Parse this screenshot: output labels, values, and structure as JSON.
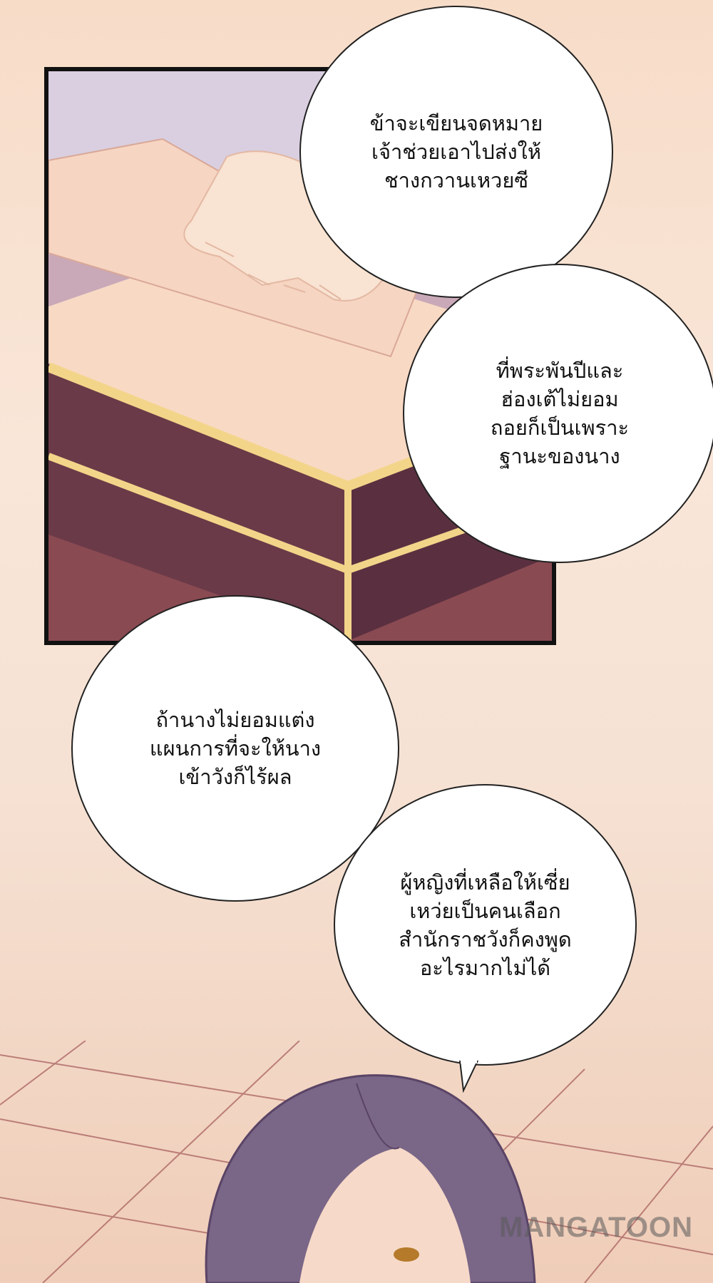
{
  "bubbles": [
    {
      "text": "ข้าจะเขียนจดหมาย\nเจ้าช่วยเอาไปส่งให้\nชางกวานเหวยซี"
    },
    {
      "text": "ที่พระพันปีและ\nฮ่องเต้ไม่ยอม\nถอยก็เป็นเพราะ\nฐานะของนาง"
    },
    {
      "text": "ถ้านางไม่ยอมแต่ง\nแผนการที่จะให้นาง\nเข้าวังก็ไร้ผล"
    },
    {
      "text": "ผู้หญิงที่เหลือให้เซี่ย\nเหว่ยเป็นคนเลือก\nสำนักราชวังก็คงพูด\nอะไรมากไม่ได้"
    }
  ],
  "watermark": "MANGATOON"
}
